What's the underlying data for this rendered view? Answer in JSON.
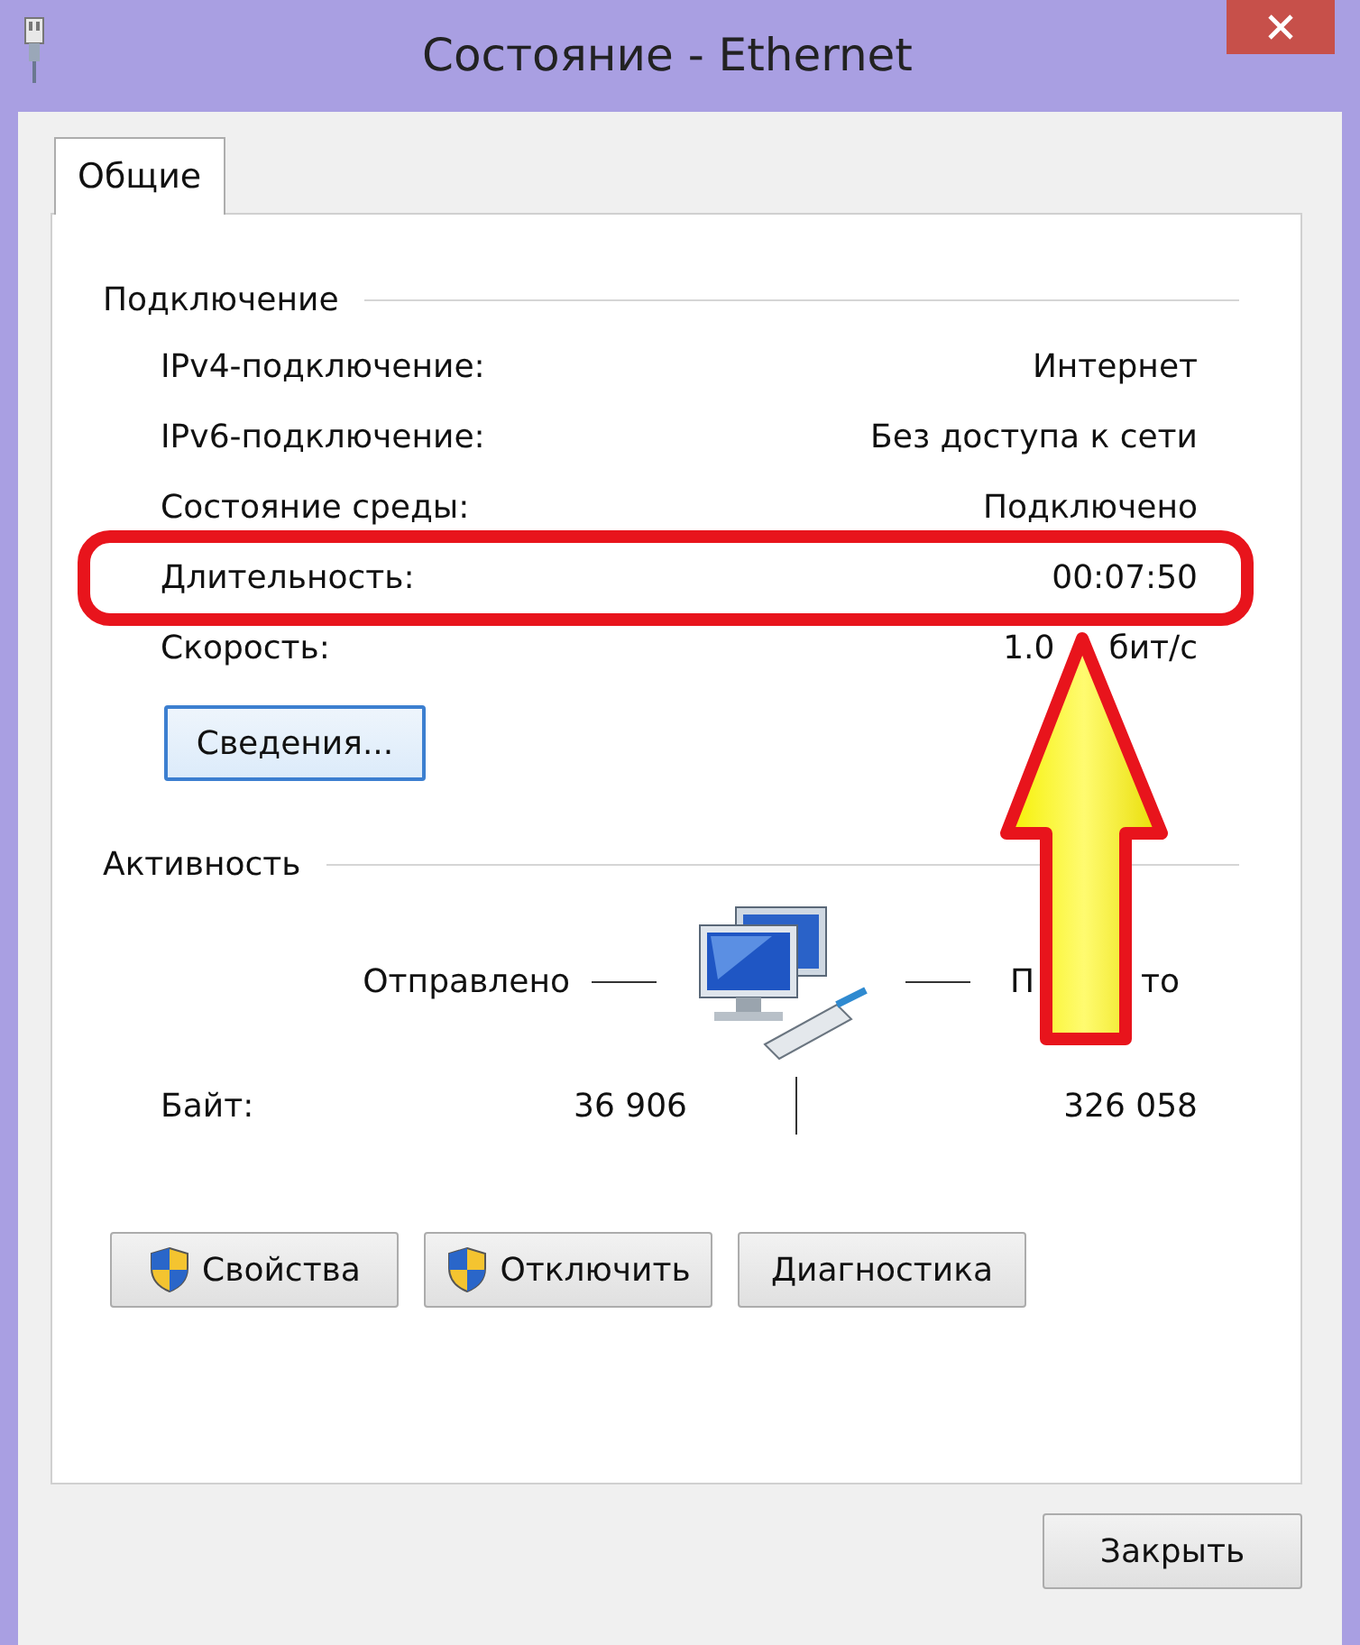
{
  "window": {
    "title": "Состояние - Ethernet"
  },
  "tabs": [
    {
      "label": "Общие",
      "selected": true
    }
  ],
  "connection": {
    "heading": "Подключение",
    "rows": [
      {
        "label": "IPv4-подключение:",
        "value": "Интернет",
        "highlighted": false
      },
      {
        "label": "IPv6-подключение:",
        "value": "Без доступа к сети",
        "highlighted": false
      },
      {
        "label": "Состояние среды:",
        "value": "Подключено",
        "highlighted": false
      },
      {
        "label": "Длительность:",
        "value": "00:07:50",
        "highlighted": true
      },
      {
        "label": "Скорость:",
        "value": "1.0",
        "value_tail": "бит/с",
        "highlighted": false
      }
    ],
    "details_button": "Сведения..."
  },
  "activity": {
    "heading": "Активность",
    "sent_label": "Отправлено",
    "received_label": "П",
    "received_label_tail": "то",
    "bytes_label": "Байт:",
    "bytes_sent": "36 906",
    "bytes_received": "326 058"
  },
  "buttons": [
    {
      "label": "Свойства",
      "shield": true
    },
    {
      "label": "Отключить",
      "shield": true
    },
    {
      "label": "Диагностика",
      "shield": false
    }
  ],
  "close_button": "Закрыть",
  "annotation": {
    "arrow": true
  }
}
